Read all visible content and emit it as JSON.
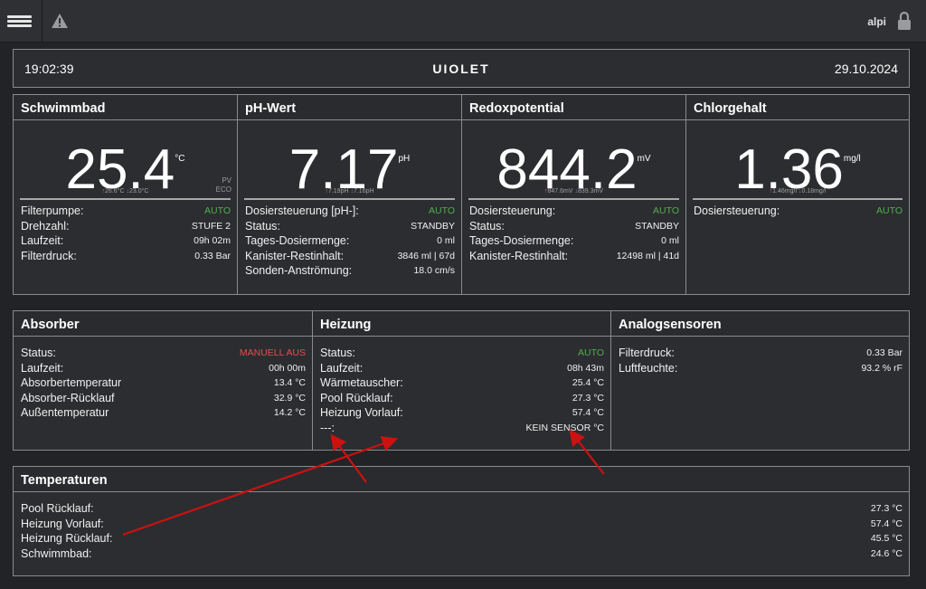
{
  "topbar": {
    "user": "alpi"
  },
  "clock": {
    "time": "19:02:39",
    "logo": "UIOLET",
    "date": "29.10.2024"
  },
  "tiles": {
    "pool": {
      "title": "Schwimmbad",
      "value": "25.4",
      "unit": "°C",
      "max": "26.6",
      "max_unit": "°C",
      "min": "23.0",
      "min_unit": "°C",
      "mode1": "PV",
      "mode2": "ECO",
      "rows": [
        {
          "label": "Filterpumpe:",
          "value": "AUTO"
        },
        {
          "label": "Drehzahl:",
          "value": "STUFE 2"
        },
        {
          "label": "Laufzeit:",
          "value": "09h 02m"
        },
        {
          "label": "Filterdruck:",
          "value": "0.33 Bar"
        }
      ]
    },
    "ph": {
      "title": "pH-Wert",
      "value": "7.17",
      "unit": "pH",
      "max": "7.19",
      "max_unit": "pH",
      "min": "7.16",
      "min_unit": "pH",
      "rows": [
        {
          "label": "Dosiersteuerung [pH-]:",
          "value": "AUTO"
        },
        {
          "label": "Status:",
          "value": "STANDBY"
        },
        {
          "label": "Tages-Dosiermenge:",
          "value": "0 ml"
        },
        {
          "label": "Kanister-Restinhalt:",
          "value": "3846 ml | 67d"
        },
        {
          "label": "Sonden-Anströmung:",
          "value": "18.0 cm/s"
        }
      ]
    },
    "redox": {
      "title": "Redoxpotential",
      "value": "844.2",
      "unit": "mV",
      "max": "847.6",
      "max_unit": "mV",
      "min": "839.3",
      "min_unit": "mV",
      "rows": [
        {
          "label": "Dosiersteuerung:",
          "value": "AUTO"
        },
        {
          "label": "Status:",
          "value": "STANDBY"
        },
        {
          "label": "Tages-Dosiermenge:",
          "value": "0 ml"
        },
        {
          "label": "Kanister-Restinhalt:",
          "value": "12498 ml | 41d"
        }
      ]
    },
    "chlor": {
      "title": "Chlorgehalt",
      "value": "1.36",
      "unit": "mg/l",
      "max": "1.46",
      "max_unit": "mg/l",
      "min": "0.18",
      "min_unit": "mg/l",
      "rows": [
        {
          "label": "Dosiersteuerung:",
          "value": "AUTO"
        }
      ]
    }
  },
  "absorber": {
    "title": "Absorber",
    "rows": [
      {
        "label": "Status:",
        "value": "MANUELL AUS"
      },
      {
        "label": "Laufzeit:",
        "value": "00h 00m"
      },
      {
        "label": "Absorbertemperatur",
        "value": "13.4 °C"
      },
      {
        "label": "Absorber-Rücklauf",
        "value": "32.9 °C"
      },
      {
        "label": "Außentemperatur",
        "value": "14.2 °C"
      }
    ]
  },
  "heizung": {
    "title": "Heizung",
    "rows": [
      {
        "label": "Status:",
        "value": "AUTO"
      },
      {
        "label": "Laufzeit:",
        "value": "08h 43m"
      },
      {
        "label": "Wärmetauscher:",
        "value": "25.4 °C"
      },
      {
        "label": "Pool Rücklauf:",
        "value": "27.3 °C"
      },
      {
        "label": "Heizung Vorlauf:",
        "value": "57.4 °C"
      },
      {
        "label": "---:",
        "value": "KEIN SENSOR °C"
      }
    ]
  },
  "analog": {
    "title": "Analogsensoren",
    "rows": [
      {
        "label": "Filterdruck:",
        "value": "0.33 Bar"
      },
      {
        "label": "Luftfeuchte:",
        "value": "93.2 % rF"
      }
    ]
  },
  "temperaturen": {
    "title": "Temperaturen",
    "rows": [
      {
        "label": "Pool Rücklauf:",
        "value": "27.3 °C"
      },
      {
        "label": "Heizung Vorlauf:",
        "value": "57.4 °C"
      },
      {
        "label": "Heizung Rücklauf:",
        "value": "45.5 °C"
      },
      {
        "label": "Schwimmbad:",
        "value": "24.6 °C"
      }
    ]
  },
  "colors": {
    "ok": "#4caf50",
    "alert": "#e05050",
    "annotation": "#cc1111"
  },
  "icons": [
    "menu-icon",
    "warning-icon",
    "lock-icon",
    "arrow-up-icon",
    "arrow-down-icon"
  ]
}
